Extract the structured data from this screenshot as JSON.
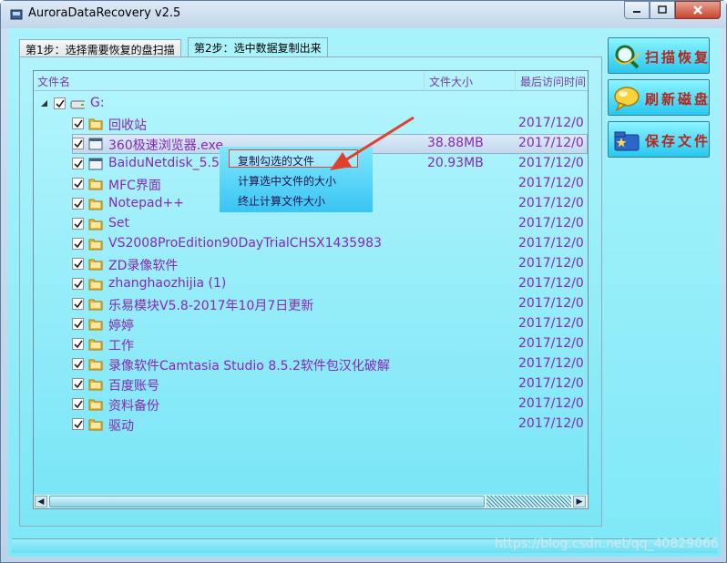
{
  "window": {
    "title": "AuroraDataRecovery v2.5"
  },
  "tabs": [
    {
      "label": "第1步：选择需要恢复的盘扫描"
    },
    {
      "label": "第2步：选中数据复制出来"
    }
  ],
  "columns": {
    "name": "文件名",
    "size": "文件大小",
    "time": "最后访问时间"
  },
  "drive": {
    "label": "G:"
  },
  "files": [
    {
      "name": "回收站",
      "size": "",
      "time": "2017/12/0",
      "type": "folder"
    },
    {
      "name": "360极速浏览器.exe",
      "size": "38.88MB",
      "time": "2017/12/0",
      "type": "file"
    },
    {
      "name": "BaiduNetdisk_5.5",
      "size": "20.93MB",
      "time": "2017/12/0",
      "type": "file"
    },
    {
      "name": "MFC界面",
      "size": "",
      "time": "2017/12/0",
      "type": "folder"
    },
    {
      "name": "Notepad++",
      "size": "",
      "time": "2017/12/0",
      "type": "folder"
    },
    {
      "name": "Set",
      "size": "",
      "time": "2017/12/0",
      "type": "folder"
    },
    {
      "name": "VS2008ProEdition90DayTrialCHSX1435983",
      "size": "",
      "time": "2017/12/0",
      "type": "folder"
    },
    {
      "name": "ZD录像软件",
      "size": "",
      "time": "2017/12/0",
      "type": "folder"
    },
    {
      "name": "zhanghaozhijia (1)",
      "size": "",
      "time": "2017/12/0",
      "type": "folder"
    },
    {
      "name": "乐易模块V5.8-2017年10月7日更新",
      "size": "",
      "time": "2017/12/0",
      "type": "folder"
    },
    {
      "name": "婷婷",
      "size": "",
      "time": "2017/12/0",
      "type": "folder"
    },
    {
      "name": "工作",
      "size": "",
      "time": "2017/12/0",
      "type": "folder"
    },
    {
      "name": "录像软件Camtasia Studio 8.5.2软件包汉化破解",
      "size": "",
      "time": "2017/12/0",
      "type": "folder"
    },
    {
      "name": "百度账号",
      "size": "",
      "time": "2017/12/0",
      "type": "folder"
    },
    {
      "name": "资料备份",
      "size": "",
      "time": "2017/12/0",
      "type": "folder"
    },
    {
      "name": "驱动",
      "size": "",
      "time": "2017/12/0",
      "type": "folder"
    }
  ],
  "context_menu": {
    "items": [
      "复制勾选的文件",
      "计算选中文件的大小",
      "终止计算文件大小"
    ]
  },
  "side_buttons": [
    {
      "label": "扫描恢复",
      "icon": "magnifier-icon"
    },
    {
      "label": "刷新磁盘",
      "icon": "speech-bubble-icon"
    },
    {
      "label": "保存文件",
      "icon": "folder-star-icon"
    }
  ],
  "watermark": "https://blog.csdn.net/qq_40829066",
  "colors": {
    "text_purple": "#8a26b8",
    "button_label": "#b5261e",
    "background_cyan": "#a9f3fb"
  }
}
